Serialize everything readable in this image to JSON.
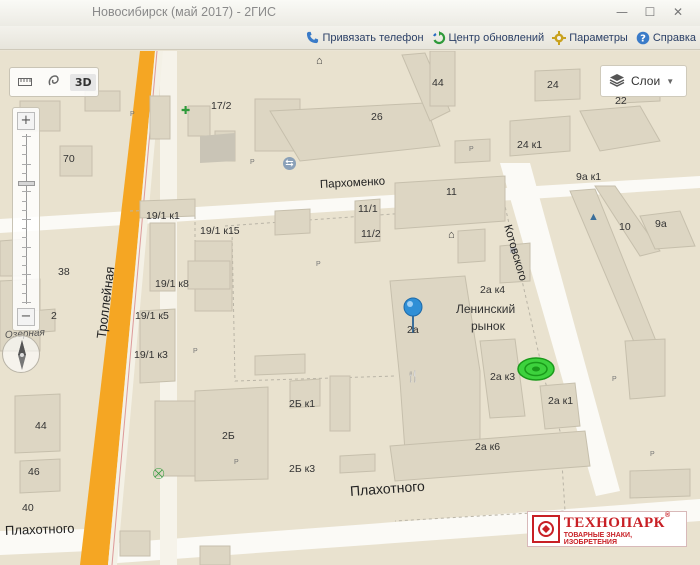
{
  "window": {
    "title": "Новосибирск (май 2017)",
    "title_sep": "-",
    "app_name": "2ГИС",
    "minimize": "—",
    "restore": "☐",
    "close": "✕"
  },
  "toolbar": {
    "items": [
      {
        "label": "Привязать телефон",
        "icon": "phone-icon"
      },
      {
        "label": "Центр обновлений",
        "icon": "refresh-icon"
      },
      {
        "label": "Параметры",
        "icon": "gear-icon"
      },
      {
        "label": "Справка",
        "icon": "help-icon"
      }
    ]
  },
  "map_controls": {
    "ruler_icon": "ruler-icon",
    "lasso_icon": "lasso-icon",
    "view_3d": "3D",
    "zoom_in": "+",
    "zoom_out": "−",
    "zoom_level_fraction": 0.27,
    "layers_label": "Слои",
    "layers_icon": "layers-icon"
  },
  "streets": {
    "parkhomenko": "Пархоменко",
    "kotovskogo": "Котовского",
    "plakhotnogo_right": "Плахотного",
    "plakhotnogo_left": "Плахотного",
    "trolleinaya": "Троллейная",
    "ozernaya": "Озёрная"
  },
  "buildings": {
    "b44_top": "44",
    "b26": "26",
    "b17_2": "17/2",
    "b70": "70",
    "b24": "24",
    "b22": "22",
    "b24k1": "24 к1",
    "b11": "11",
    "b9ak1": "9а к1",
    "b9a": "9а",
    "b10": "10",
    "b19_1k1": "19/1 к1",
    "b19_1k15": "19/1 к15",
    "b11_1": "11/1",
    "b11_2": "11/2",
    "b38": "38",
    "b2": "2",
    "b19_1k8": "19/1 к8",
    "b19_1k5": "19/1 к5",
    "b19_1k3": "19/1 к3",
    "b2ak4": "2а к4",
    "market_line1": "Ленинский",
    "market_line2": "рынок",
    "b2a": "2а",
    "b2ak3": "2а к3",
    "b2ak1": "2а к1",
    "b2bk1": "2Б к1",
    "b2b": "2Б",
    "b44_left": "44",
    "b2ak6": "2а к6",
    "b46": "46",
    "b2bk3": "2Б к3",
    "b40": "40",
    "parking": "P"
  },
  "watermark": {
    "brand": "ТЕХНОПАРК",
    "reg": "®",
    "subtitle": "ТОВАРНЫЕ ЗНАКИ, ИЗОБРЕТЕНИЯ"
  },
  "colors": {
    "trolleinaya_road": "#f5a623",
    "map_base": "#e9e2cf",
    "marker": "#2f8fd6",
    "target_ring": "#22cc22",
    "brand_red": "#c81f25"
  }
}
